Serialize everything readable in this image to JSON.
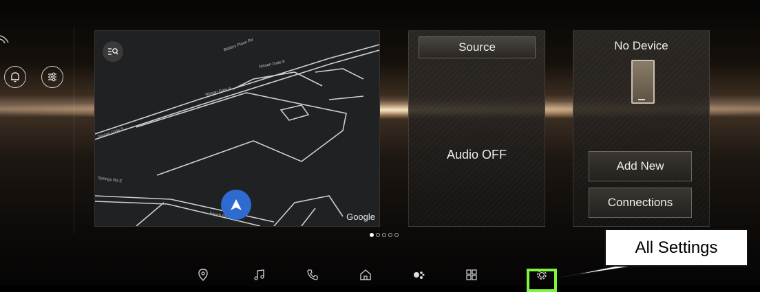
{
  "map": {
    "attribution": "Google",
    "streets": [
      "Nissan Gate 9",
      "Nissan Gate 9",
      "Nissan Gate 8",
      "Battery Place Rd",
      "Springs Rd E",
      "Enoch Blvd"
    ]
  },
  "audio": {
    "source_label": "Source",
    "status": "Audio OFF"
  },
  "device": {
    "title": "No Device",
    "add_new_label": "Add New",
    "connections_label": "Connections"
  },
  "pager": {
    "count": 5,
    "active": 0
  },
  "dock": {
    "items": [
      "location-pin-icon",
      "music-note-icon",
      "phone-icon",
      "home-icon",
      "assistant-icon",
      "apps-grid-icon",
      "settings-gear-icon"
    ]
  },
  "callout": {
    "text": "All Settings"
  },
  "colors": {
    "highlight": "#7ef542",
    "nav_arrow": "#2f6ad0"
  }
}
